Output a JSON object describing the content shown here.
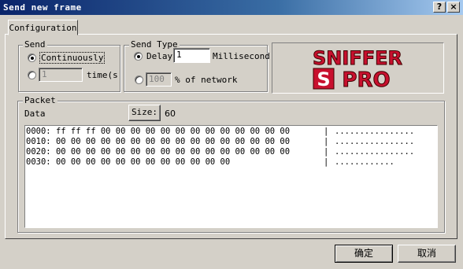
{
  "window": {
    "title": "Send new frame",
    "help_glyph": "?",
    "close_glyph": "×"
  },
  "tab": {
    "label": "Configuration"
  },
  "send": {
    "legend": "Send",
    "continuously_label": "Continuously",
    "times_value": "1",
    "times_label": "time(s",
    "selected": "continuously"
  },
  "send_type": {
    "legend": "Send Type",
    "delay_label": "Delay",
    "delay_value": "1",
    "delay_unit": "Millisecond",
    "percent_value": "100",
    "percent_label": "% of network",
    "selected": "delay"
  },
  "logo": {
    "line1": "SNIFFER",
    "line2_s": "S",
    "line2_rest": "PRO"
  },
  "packet": {
    "legend": "Packet",
    "data_label": "Data",
    "size_button": "Size:",
    "size_value": "60",
    "rows": [
      {
        "offset": "0000:",
        "bytes": "ff ff ff 00 00 00 00 00 00 00 00 00 00 00 00 00",
        "sep": "|",
        "ascii": "................"
      },
      {
        "offset": "0010:",
        "bytes": "00 00 00 00 00 00 00 00 00 00 00 00 00 00 00 00",
        "sep": "|",
        "ascii": "................"
      },
      {
        "offset": "0020:",
        "bytes": "00 00 00 00 00 00 00 00 00 00 00 00 00 00 00 00",
        "sep": "|",
        "ascii": "................"
      },
      {
        "offset": "0030:",
        "bytes": "00 00 00 00 00 00 00 00 00 00 00 00",
        "sep": "|",
        "ascii": "............"
      }
    ]
  },
  "buttons": {
    "ok": "确定",
    "cancel": "取消"
  },
  "colors": {
    "title_start": "#0a246a",
    "title_end": "#a6caf0",
    "logo_red": "#c8102e",
    "face": "#d4d0c8"
  }
}
